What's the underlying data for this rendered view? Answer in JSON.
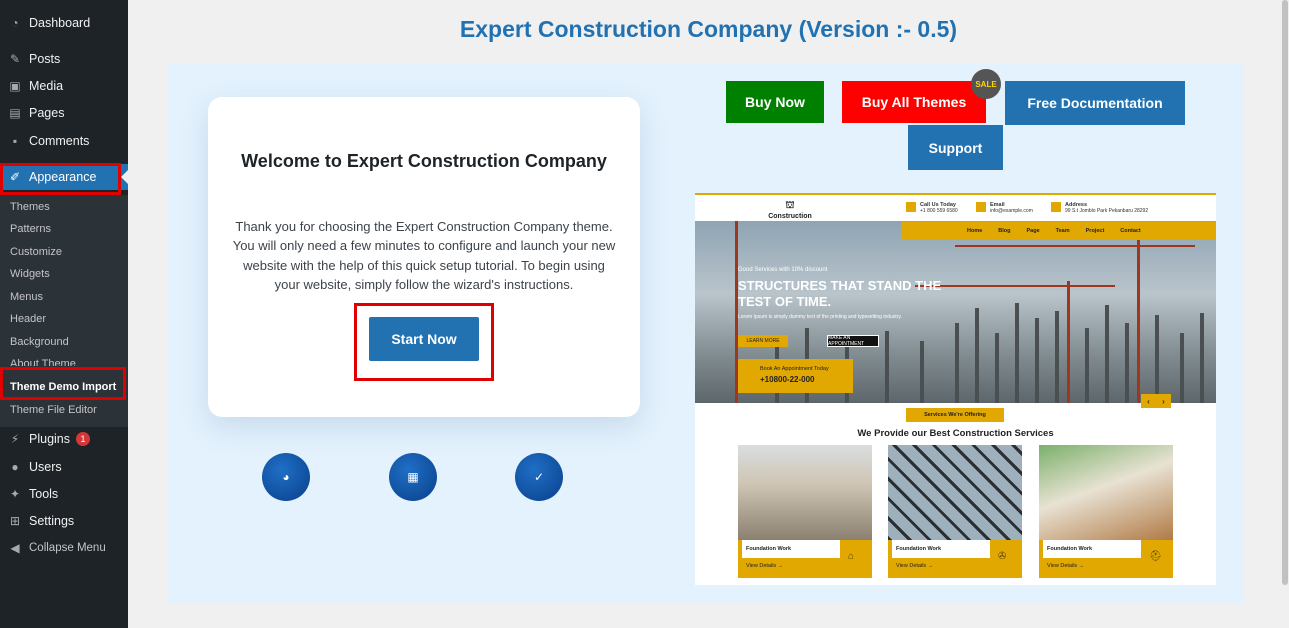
{
  "sidebar": {
    "items": [
      {
        "label": "Dashboard",
        "icon": "dashboard-icon"
      },
      {
        "label": "Posts",
        "icon": "pin-icon"
      },
      {
        "label": "Media",
        "icon": "media-icon"
      },
      {
        "label": "Pages",
        "icon": "pages-icon"
      },
      {
        "label": "Comments",
        "icon": "comment-icon"
      },
      {
        "label": "Appearance",
        "icon": "brush-icon"
      },
      {
        "label": "Plugins",
        "icon": "plug-icon",
        "badge": "1"
      },
      {
        "label": "Users",
        "icon": "user-icon"
      },
      {
        "label": "Tools",
        "icon": "wrench-icon"
      },
      {
        "label": "Settings",
        "icon": "settings-icon"
      },
      {
        "label": "Collapse Menu",
        "icon": "collapse-icon"
      }
    ],
    "submenu": [
      "Themes",
      "Patterns",
      "Customize",
      "Widgets",
      "Menus",
      "Header",
      "Background",
      "About Theme",
      "Theme Demo Import",
      "Theme File Editor"
    ]
  },
  "page_title": "Expert Construction Company (Version :- 0.5)",
  "welcome": {
    "title": "Welcome to Expert Construction Company",
    "text": "Thank you for choosing the Expert Construction Company theme. You will only need a few minutes to configure and launch your new website with the help of this quick setup tutorial. To begin using your website, simply follow the wizard's instructions.",
    "start_label": "Start Now"
  },
  "buttons": {
    "buy_now": "Buy Now",
    "buy_all": "Buy All Themes",
    "sale": "SALE",
    "docs": "Free Documentation",
    "support": "Support"
  },
  "preview": {
    "logo": "Construction",
    "contacts": [
      {
        "title": "Call Us Today",
        "value": "+1 800 559 6580"
      },
      {
        "title": "Email",
        "value": "info@example.com"
      },
      {
        "title": "Address",
        "value": "99 S.t Jomblo Park Pekanbaru 28292"
      }
    ],
    "nav": [
      "Home",
      "Blog",
      "Page",
      "Team",
      "Project",
      "Contact"
    ],
    "hero_sub": "Good Services with 10% discount",
    "hero_title": "STRUCTURES THAT STAND THE TEST OF TIME.",
    "hero_desc": "Lorem Ipsum is simply dummy text of the printing and typesetting industry.",
    "learn_more": "LEARN MORE",
    "appointment_btn": "MAKE AN APPOINTMENT",
    "appoint_label": "Book An Appointment Today",
    "appoint_phone": "+10800-22-000",
    "services_tag": "Services We're Offering",
    "services_title": "We Provide our Best Construction Services",
    "cards": [
      {
        "label": "Foundation Work",
        "link": "View Details →"
      },
      {
        "label": "Foundation Work",
        "link": "View Details →"
      },
      {
        "label": "Foundation Work",
        "link": "View Details →"
      }
    ]
  },
  "colors": {
    "accent": "#2271b1",
    "buy_now": "#008000",
    "buy_all": "#ff0000",
    "preview_yellow": "#e0a800",
    "sidebar": "#1d2327"
  }
}
